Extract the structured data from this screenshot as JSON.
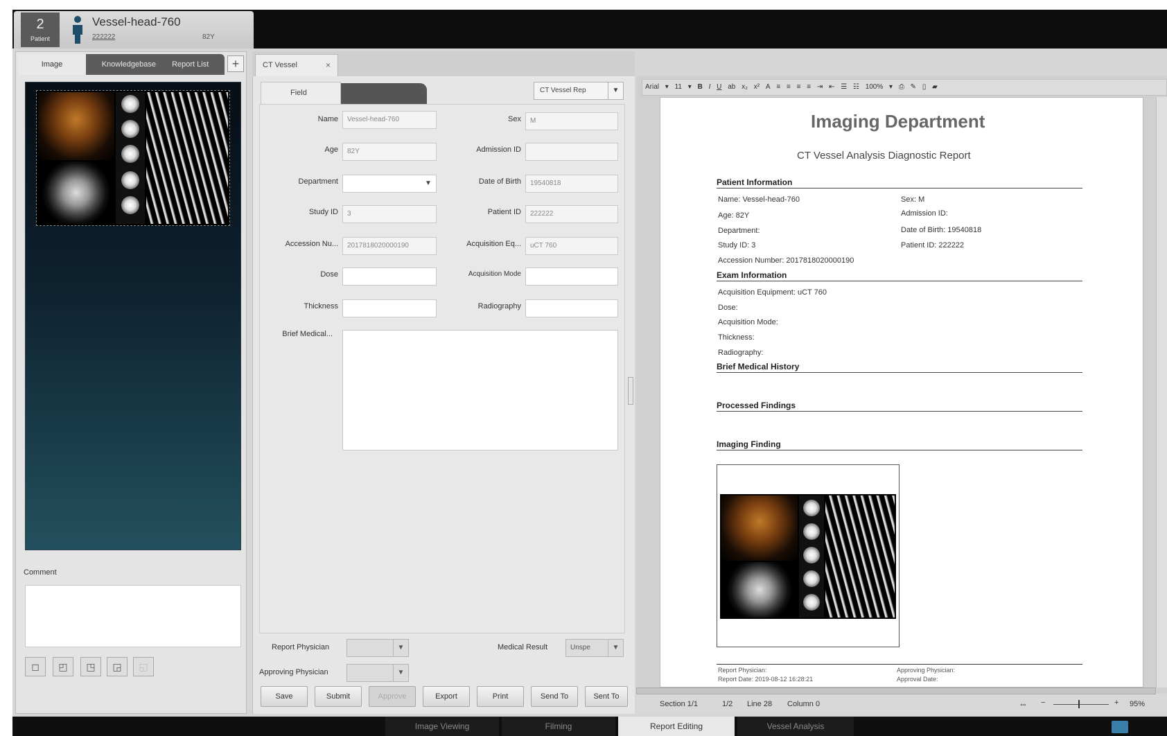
{
  "patient": {
    "count_num": "2",
    "count_sub": "Patient",
    "name": "Vessel-head-760",
    "id": "222222",
    "age": "82Y"
  },
  "left_panel": {
    "tabs": [
      "Image",
      "Knowledgebase",
      "Report List"
    ],
    "add_tab": "+",
    "comment_label": "Comment",
    "comment_value": ""
  },
  "mid_panel": {
    "tab_label": "CT Vessel",
    "close_label": "×",
    "field_tab": "Field",
    "template_select": "CT Vessel Rep",
    "fields": {
      "name": {
        "label": "Name",
        "value": "Vessel-head-760"
      },
      "sex": {
        "label": "Sex",
        "value": "M"
      },
      "age": {
        "label": "Age",
        "value": "82Y"
      },
      "admission_id": {
        "label": "Admission ID",
        "value": ""
      },
      "department": {
        "label": "Department",
        "value": ""
      },
      "date_of_birth": {
        "label": "Date of Birth",
        "value": "19540818"
      },
      "study_id": {
        "label": "Study ID",
        "value": "3"
      },
      "patient_id": {
        "label": "Patient ID",
        "value": "222222"
      },
      "accession_number": {
        "label": "Accession Nu...",
        "value": "2017818020000190"
      },
      "acquisition_equipment": {
        "label": "Acquisition Eq...",
        "value": "uCT 760"
      },
      "dose": {
        "label": "Dose",
        "value": ""
      },
      "acquisition_mode": {
        "label": "Acquisition Mode",
        "value": ""
      },
      "thickness": {
        "label": "Thickness",
        "value": ""
      },
      "radiography": {
        "label": "Radiography",
        "value": ""
      },
      "brief_history": {
        "label": "Brief Medical...",
        "value": ""
      }
    },
    "report_physician_label": "Report Physician",
    "report_physician_value": "",
    "approving_physician_label": "Approving Physician",
    "approving_physician_value": "",
    "medical_result_label": "Medical Result",
    "medical_result_value": "Unspe",
    "buttons": {
      "save": "Save",
      "submit": "Submit",
      "approve": "Approve",
      "export": "Export",
      "print": "Print",
      "send_to": "Send To",
      "sent_to": "Sent To"
    }
  },
  "editor_toolbar": {
    "font": "Arial",
    "size": "11",
    "zoom": "100%"
  },
  "report": {
    "title": "Imaging Department",
    "subtitle": "CT Vessel Analysis Diagnostic Report",
    "sections": {
      "patient_info": "Patient Information",
      "exam_info": "Exam Information",
      "brief_history": "Brief Medical History",
      "processed_findings": "Processed Findings",
      "imaging_finding": "Imaging Finding"
    },
    "patient_lines_left": [
      "Name: Vessel-head-760",
      "Age: 82Y",
      "Department:",
      "Study ID: 3",
      "Accession Number: 2017818020000190"
    ],
    "patient_lines_right": [
      "Sex: M",
      "Admission ID:",
      "Date of Birth: 19540818",
      "Patient ID: 222222"
    ],
    "exam_lines": [
      "Acquisition Equipment: uCT 760",
      "Dose:",
      "Acquisition Mode:",
      "Thickness:",
      "Radiography:"
    ],
    "footer_left_1": "Report Physician:",
    "footer_left_2": "Report Date: 2019-08-12 16:28:21",
    "footer_right_1": "Approving Physician:",
    "footer_right_2": "Approval Date:"
  },
  "status": {
    "section": "Section 1/1",
    "page": "1/2",
    "line": "Line 28",
    "column": "Column 0",
    "zoom": "95%"
  },
  "bottom_tabs": [
    "Image Viewing",
    "Filming",
    "Report Editing",
    "Vessel Analysis"
  ]
}
